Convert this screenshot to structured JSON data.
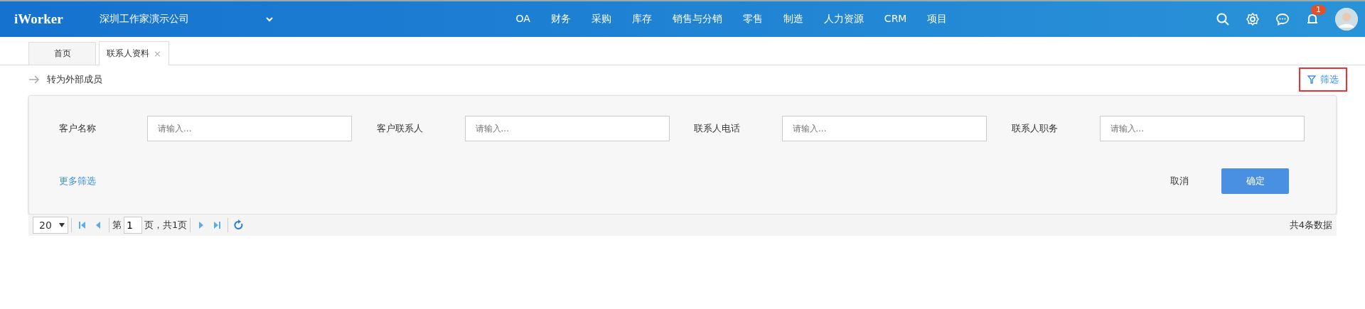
{
  "header": {
    "logo": "iWorker",
    "company": "深圳工作家演示公司",
    "nav": [
      "OA",
      "财务",
      "采购",
      "库存",
      "销售与分销",
      "零售",
      "制造",
      "人力资源",
      "CRM",
      "项目"
    ],
    "notification_count": "1"
  },
  "tabs": [
    {
      "label": "首页",
      "selected": false
    },
    {
      "label": "联系人资料",
      "selected": true,
      "close": "×"
    }
  ],
  "toolbar": {
    "action": "转为外部成员",
    "filter": "筛选"
  },
  "filter_panel": {
    "fields": [
      {
        "label": "客户名称",
        "placeholder": "请输入..."
      },
      {
        "label": "客户联系人",
        "placeholder": "请输入..."
      },
      {
        "label": "联系人电话",
        "placeholder": "请输入..."
      },
      {
        "label": "联系人职务",
        "placeholder": "请输入..."
      }
    ],
    "more": "更多筛选",
    "cancel": "取消",
    "confirm": "确定"
  },
  "pager": {
    "page_size": "20",
    "page_prefix": "第",
    "page": "1",
    "page_suffix": "页，共1页",
    "total": "共4条数据"
  }
}
